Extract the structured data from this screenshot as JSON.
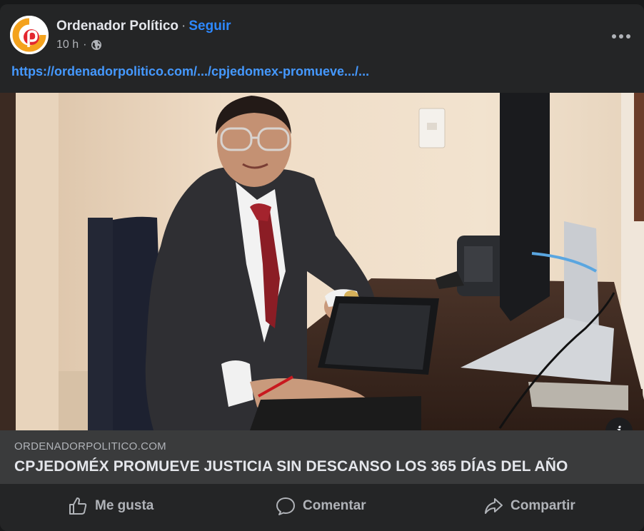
{
  "post": {
    "page_name": "Ordenador Político",
    "separator": "·",
    "follow_label": "Seguir",
    "time": "10 h",
    "meta_separator": "·",
    "audience_icon": "globe-icon",
    "more_icon": "more-options-icon",
    "link_text": "https://ordenadorpolitico.com/.../cpjedomex-promueve.../..."
  },
  "link_preview": {
    "domain": "ORDENADORPOLITICO.COM",
    "headline": "CPJEDOMÉX PROMUEVE JUSTICIA SIN DESCANSO LOS 365 DÍAS DEL AÑO",
    "info_icon": "info-icon",
    "info_glyph": "i"
  },
  "actions": {
    "like_label": "Me gusta",
    "comment_label": "Comentar",
    "share_label": "Compartir"
  },
  "colors": {
    "background": "#18191a",
    "card": "#242526",
    "link_box": "#3a3b3c",
    "accent": "#2d88ff",
    "link": "#4599ff",
    "text_primary": "#e4e6eb",
    "text_secondary": "#b0b3b8",
    "logo_orange": "#f4a21d",
    "logo_red": "#e3262f"
  }
}
